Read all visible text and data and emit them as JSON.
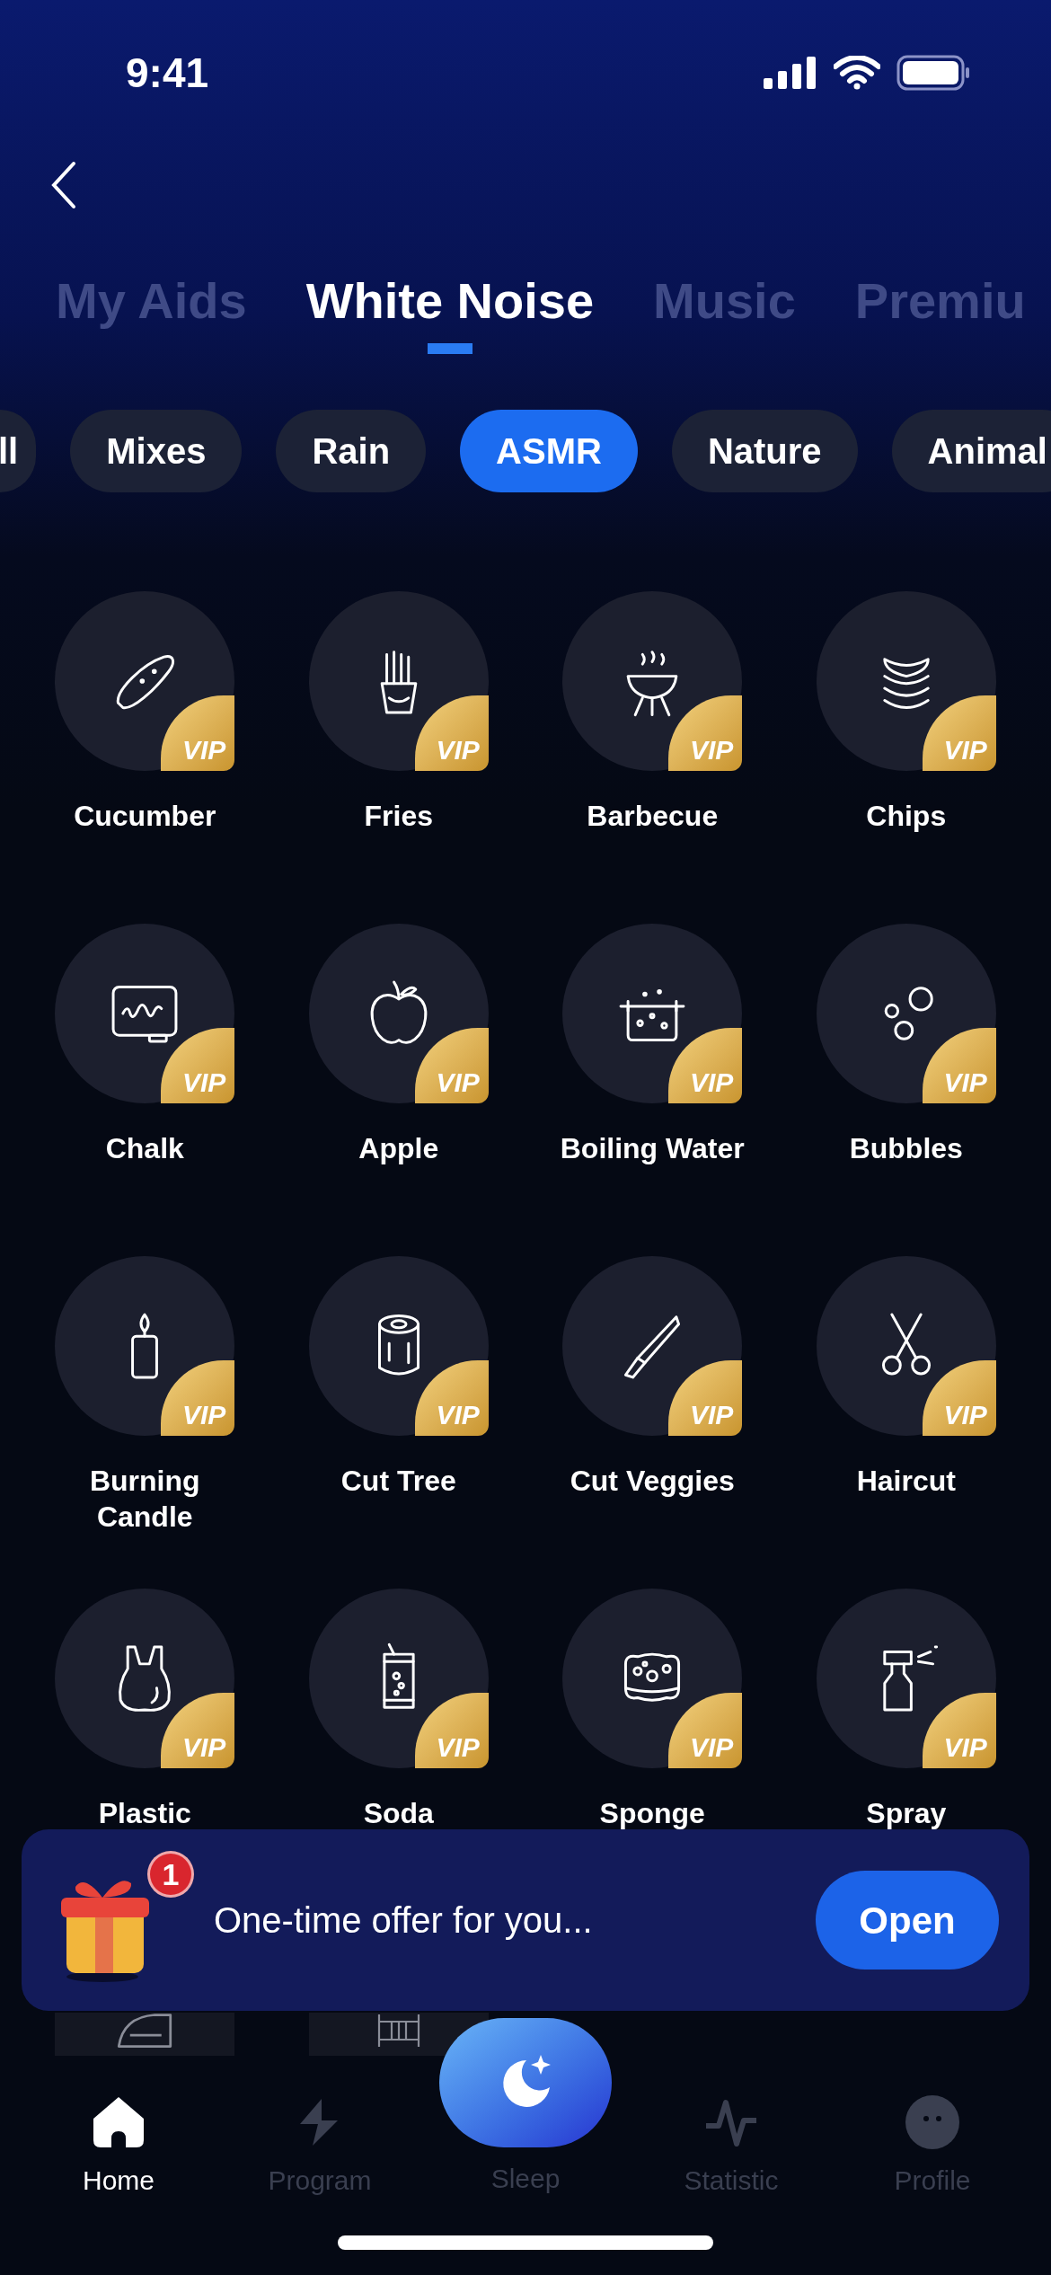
{
  "status_bar": {
    "time": "9:41"
  },
  "tabs": [
    {
      "label": "My Aids",
      "selected": false
    },
    {
      "label": "White Noise",
      "selected": true
    },
    {
      "label": "Music",
      "selected": false
    },
    {
      "label": "Premiu",
      "selected": false
    }
  ],
  "chips": [
    {
      "label": "ll",
      "selected": false
    },
    {
      "label": "Mixes",
      "selected": false
    },
    {
      "label": "Rain",
      "selected": false
    },
    {
      "label": "ASMR",
      "selected": true
    },
    {
      "label": "Nature",
      "selected": false
    },
    {
      "label": "Animal",
      "selected": false
    }
  ],
  "sounds": [
    {
      "label": "Cucumber",
      "badge": "VIP",
      "kind": "full"
    },
    {
      "label": "Fries",
      "badge": "VIP",
      "kind": "full"
    },
    {
      "label": "Barbecue",
      "badge": "VIP",
      "kind": "full"
    },
    {
      "label": "Chips",
      "badge": "VIP",
      "kind": "full"
    },
    {
      "label": "Chalk",
      "badge": "VIP",
      "kind": "full"
    },
    {
      "label": "Apple",
      "badge": "VIP",
      "kind": "full"
    },
    {
      "label": "Boiling Water",
      "badge": "VIP",
      "kind": "full"
    },
    {
      "label": "Bubbles",
      "badge": "VIP",
      "kind": "full"
    },
    {
      "label": "Burning Candle",
      "badge": "VIP",
      "kind": "full"
    },
    {
      "label": "Cut Tree",
      "badge": "VIP",
      "kind": "full"
    },
    {
      "label": "Cut Veggies",
      "badge": "VIP",
      "kind": "full"
    },
    {
      "label": "Haircut",
      "badge": "VIP",
      "kind": "full"
    },
    {
      "label": "Plastic",
      "badge": "VIP",
      "kind": "full"
    },
    {
      "label": "Soda",
      "badge": "VIP",
      "kind": "full"
    },
    {
      "label": "Sponge",
      "badge": "VIP",
      "kind": "full"
    },
    {
      "label": "Spray",
      "badge": "VIP",
      "kind": "full"
    },
    {
      "kind": "partial"
    },
    {
      "kind": "partial"
    }
  ],
  "offer": {
    "badge": "1",
    "text": "One-time offer for you...",
    "button": "Open"
  },
  "nav": [
    {
      "label": "Home",
      "selected": true,
      "kind": "tab"
    },
    {
      "label": "Program",
      "selected": false,
      "kind": "tab"
    },
    {
      "label": "Sleep",
      "selected": false,
      "kind": "center"
    },
    {
      "label": "Statistic",
      "selected": false,
      "kind": "tab"
    },
    {
      "label": "Profile",
      "selected": false,
      "kind": "tab"
    }
  ]
}
